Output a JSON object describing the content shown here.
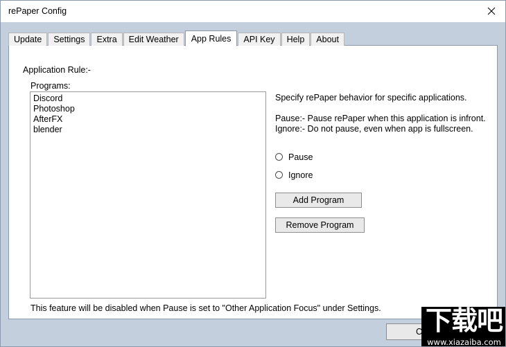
{
  "window": {
    "title": "rePaper Config",
    "close_icon": "close-icon"
  },
  "tabs": [
    {
      "label": "Update",
      "active": false
    },
    {
      "label": "Settings",
      "active": false
    },
    {
      "label": "Extra",
      "active": false
    },
    {
      "label": "Edit Weather",
      "active": false
    },
    {
      "label": "App Rules",
      "active": true
    },
    {
      "label": "API Key",
      "active": false
    },
    {
      "label": "Help",
      "active": false
    },
    {
      "label": "About",
      "active": false
    }
  ],
  "main": {
    "section_title": "Application Rule:-",
    "programs_label": "Programs:",
    "programs": [
      "Discord",
      "Photoshop",
      "AfterFX",
      "blender"
    ],
    "description": [
      "Specify rePaper behavior for specific applications.",
      "",
      "Pause:- Pause rePaper when this application is infront.",
      "Ignore:- Do not pause, even when app is fullscreen."
    ],
    "radio_options": [
      {
        "label": "Pause",
        "selected": false
      },
      {
        "label": "Ignore",
        "selected": false
      }
    ],
    "add_program_label": "Add Program",
    "remove_program_label": "Remove Program",
    "footer_note": "This feature will be disabled when Pause is set to \"Other Application Focus\" under Settings."
  },
  "dialog": {
    "cancel_label": "Cancel"
  },
  "watermark": {
    "text": "下载吧",
    "url": "www.xiazaiba.com"
  }
}
